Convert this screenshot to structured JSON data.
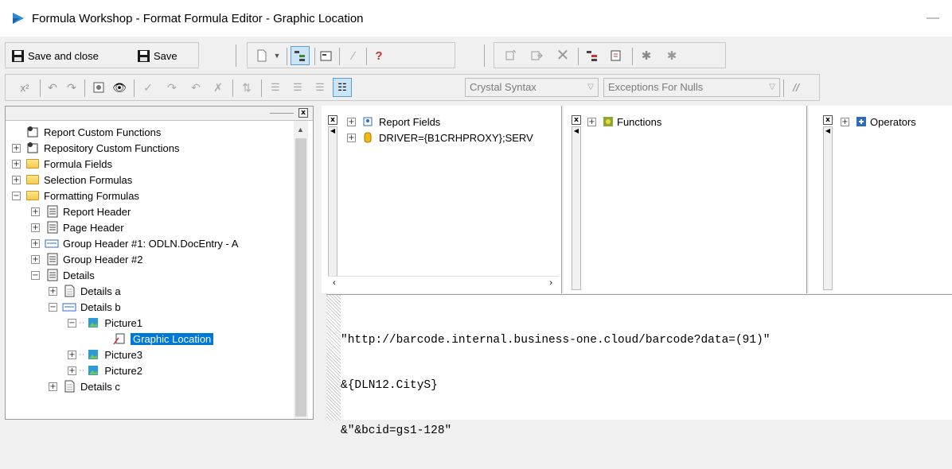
{
  "window": {
    "title": "Formula Workshop - Format Formula Editor - Graphic Location",
    "minimize_symbol": "—"
  },
  "toolbar": {
    "save_and_close_label": "Save and close",
    "save_label": "Save",
    "syntax_select": "Crystal Syntax",
    "nulls_select": "Exceptions For Nulls",
    "comment_label": "//"
  },
  "tree": {
    "items": [
      {
        "label": "Report Custom Functions"
      },
      {
        "label": "Repository Custom Functions"
      },
      {
        "label": "Formula Fields"
      },
      {
        "label": "Selection Formulas"
      },
      {
        "label": "Formatting Formulas"
      },
      {
        "label": "Report Header"
      },
      {
        "label": "Page Header"
      },
      {
        "label": "Group Header #1: ODLN.DocEntry - A"
      },
      {
        "label": "Group Header #2"
      },
      {
        "label": "Details"
      },
      {
        "label": "Details a"
      },
      {
        "label": "Details b"
      },
      {
        "label": "Picture1"
      },
      {
        "label": "Graphic Location"
      },
      {
        "label": "Picture3"
      },
      {
        "label": "Picture2"
      },
      {
        "label": "Details c"
      }
    ]
  },
  "panes": {
    "fields": {
      "items": [
        {
          "label": "Report Fields"
        },
        {
          "label": "DRIVER={B1CRHPROXY};SERV"
        }
      ]
    },
    "functions": {
      "items": [
        {
          "label": "Functions"
        }
      ]
    },
    "operators": {
      "items": [
        {
          "label": "Operators"
        }
      ]
    }
  },
  "editor": {
    "lines": [
      "\"http://barcode.internal.business-one.cloud/barcode?data=(91)\"",
      "&{DLN12.CityS}",
      "&\"&bcid=gs1-128\""
    ]
  },
  "colors": {
    "selection": "#0078d7",
    "folder": "#f7c94a"
  }
}
